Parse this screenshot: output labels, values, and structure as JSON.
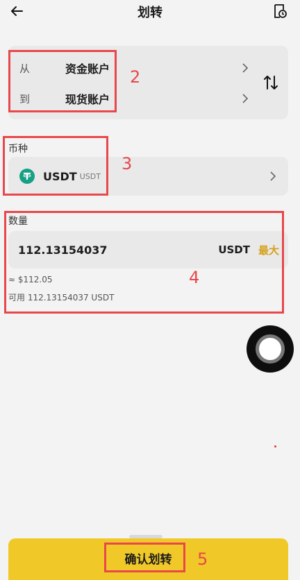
{
  "header": {
    "title": "划转"
  },
  "transfer": {
    "from_label": "从",
    "from_account": "资金账户",
    "to_label": "到",
    "to_account": "现货账户"
  },
  "coin": {
    "section_label": "币种",
    "symbol": "USDT",
    "name": "USDT"
  },
  "amount": {
    "section_label": "数量",
    "value": "112.13154037",
    "unit": "USDT",
    "max_label": "最大",
    "approx": "≈ $112.05",
    "available": "可用 112.13154037 USDT"
  },
  "confirm": {
    "label": "确认划转"
  },
  "annotations": [
    "2",
    "3",
    "4",
    "5"
  ],
  "colors": {
    "accent": "#f0c929",
    "max": "#d6a21c",
    "annotation": "#e8474b",
    "tether": "#16a085"
  }
}
